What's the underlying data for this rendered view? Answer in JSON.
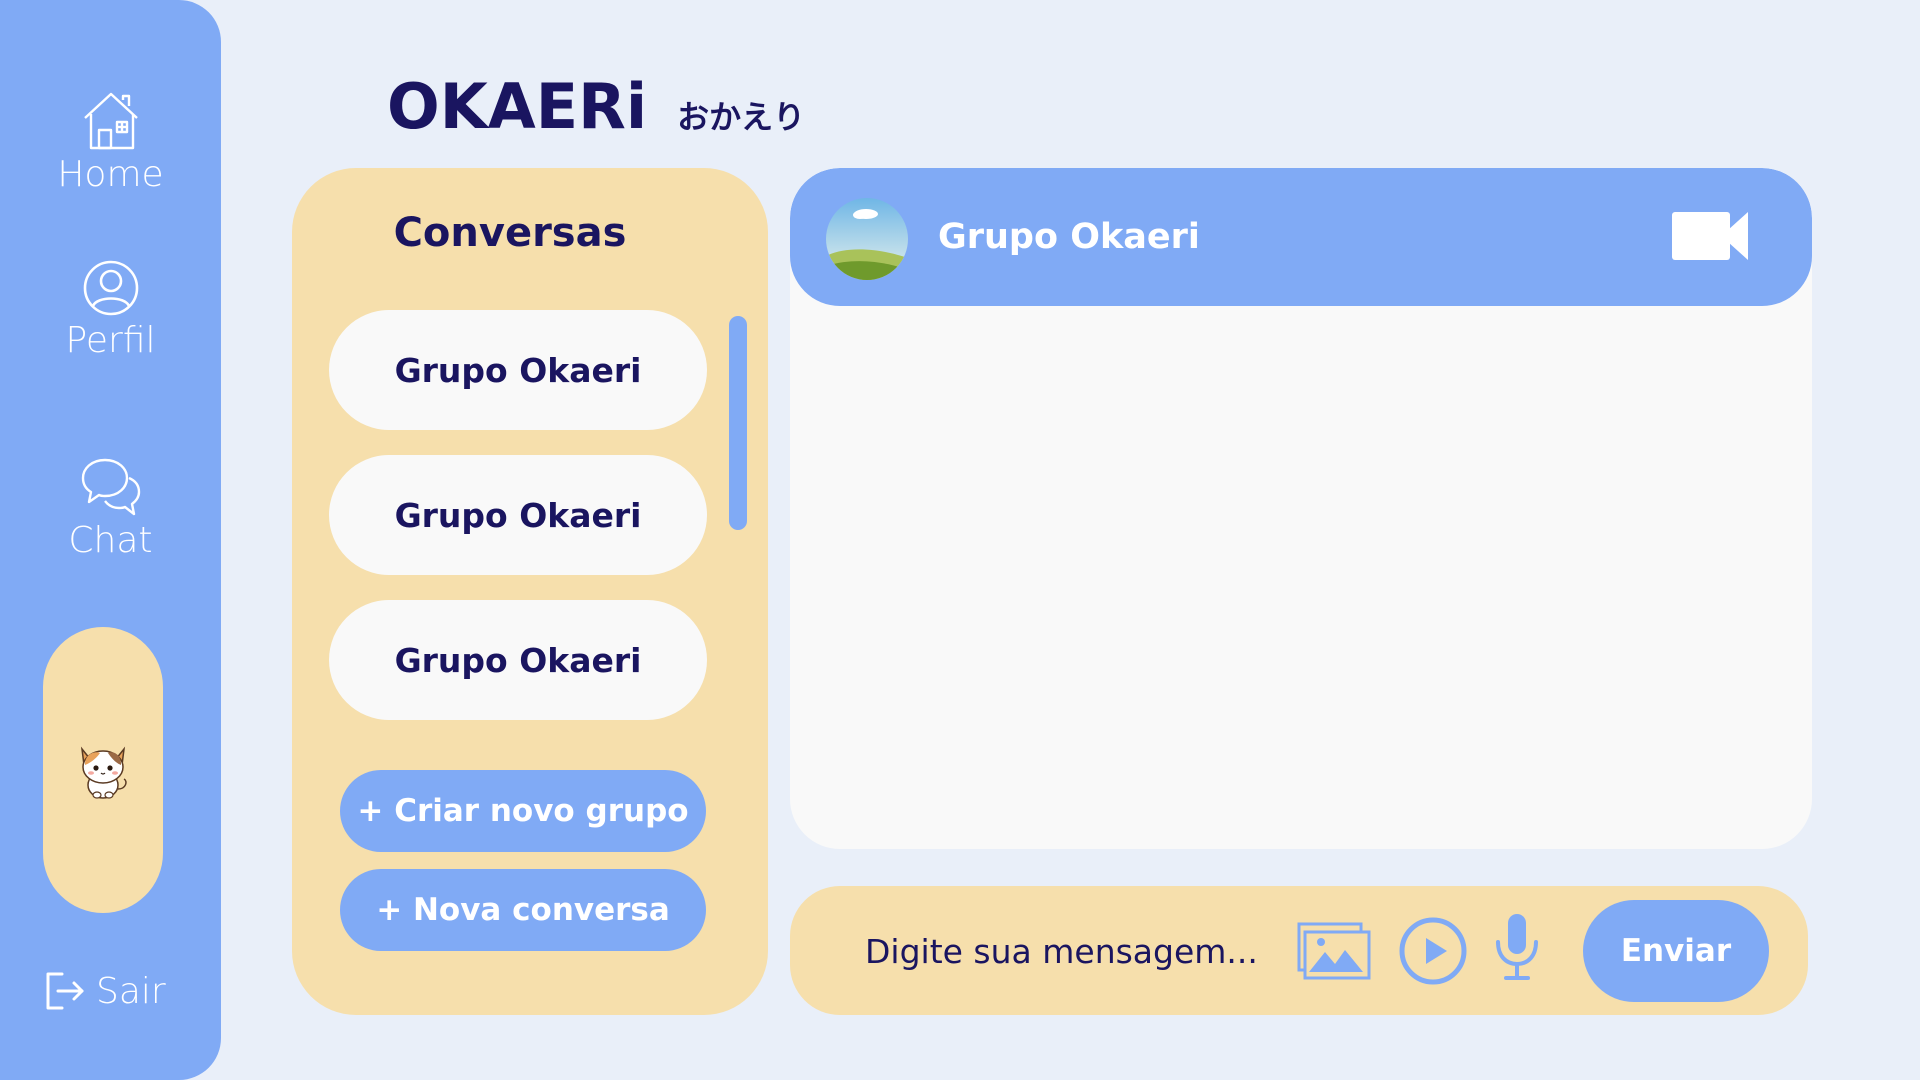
{
  "sidebar": {
    "items": [
      {
        "label": "Home",
        "icon": "home-icon"
      },
      {
        "label": "Perfil",
        "icon": "user-icon"
      },
      {
        "label": "Chat",
        "icon": "chat-icon"
      }
    ],
    "logout_label": "Sair"
  },
  "brand": {
    "logo": "OKAERi",
    "kana": "おかえり"
  },
  "conversations": {
    "title": "Conversas",
    "items": [
      {
        "name": "Grupo Okaeri"
      },
      {
        "name": "Grupo Okaeri"
      },
      {
        "name": "Grupo Okaeri"
      }
    ],
    "create_group_label": "+ Criar novo grupo",
    "new_conversation_label": "+ Nova conversa"
  },
  "chat": {
    "group_name": "Grupo Okaeri",
    "input_placeholder": "Digite sua mensagem...",
    "send_label": "Enviar"
  },
  "colors": {
    "primary_blue": "#80aaf5",
    "panel_yellow": "#f6dfac",
    "navy_text": "#1a1560",
    "background": "#e9eff9"
  }
}
